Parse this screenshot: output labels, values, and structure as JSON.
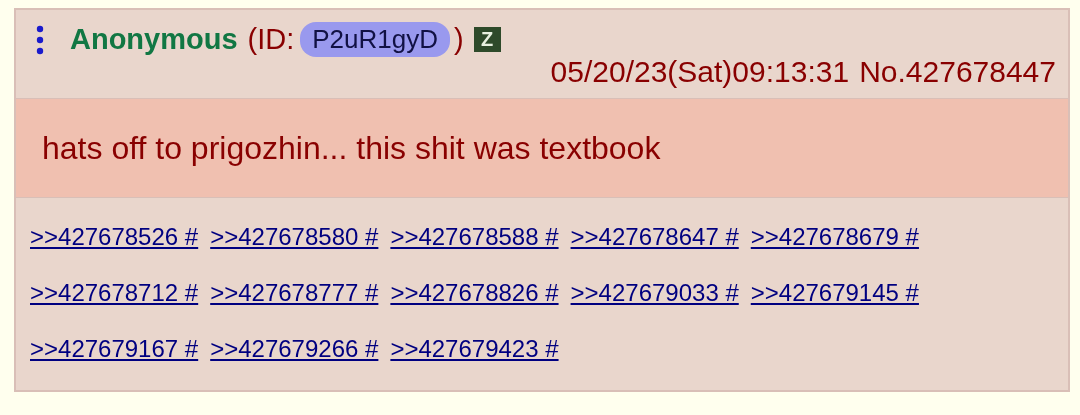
{
  "post": {
    "name": "Anonymous",
    "id_prefix": "(ID:",
    "id": "P2uR1gyD",
    "id_suffix": ")",
    "flag": "Z",
    "datetime": "05/20/23(Sat)09:13:31",
    "number": "No.427678447",
    "message": "hats off to prigozhin... this shit was textbook",
    "replies": [
      ">>427678526 #",
      ">>427678580 #",
      ">>427678588 #",
      ">>427678647 #",
      ">>427678679 #",
      ">>427678712 #",
      ">>427678777 #",
      ">>427678826 #",
      ">>427679033 #",
      ">>427679145 #",
      ">>427679167 #",
      ">>427679266 #",
      ">>427679423 #"
    ]
  }
}
